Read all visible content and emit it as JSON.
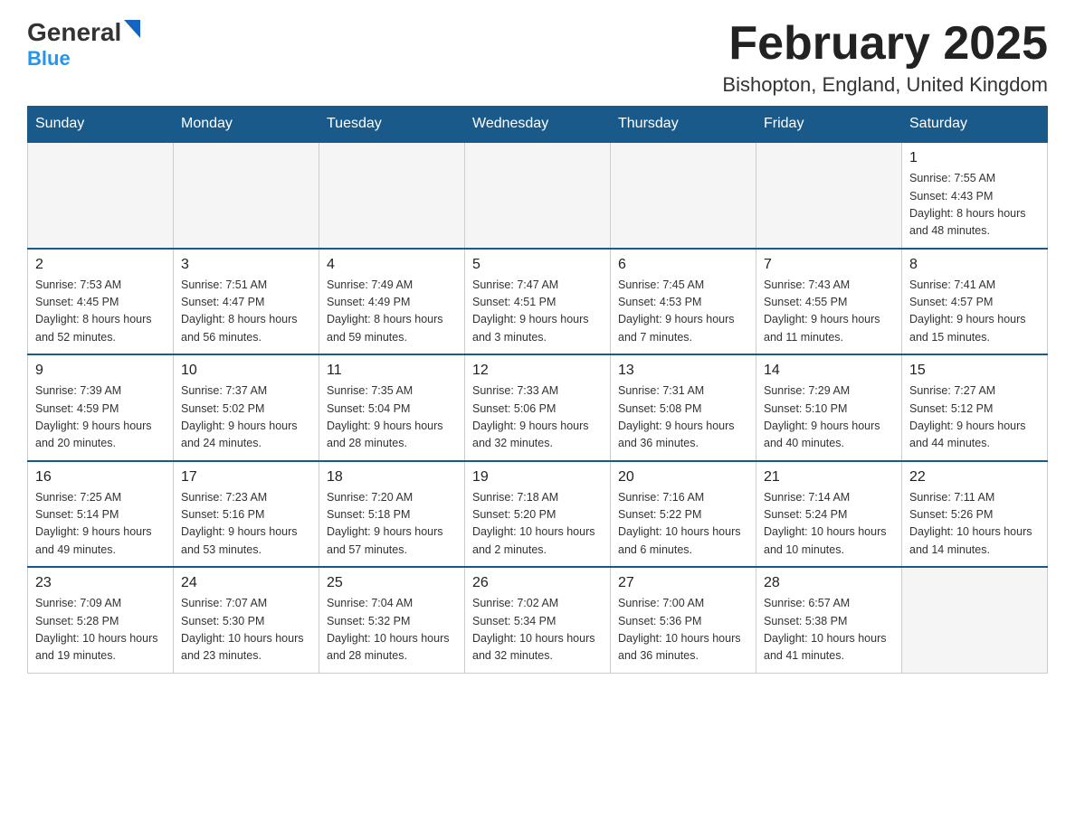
{
  "header": {
    "logo_general": "General",
    "logo_blue": "Blue",
    "month_title": "February 2025",
    "location": "Bishopton, England, United Kingdom"
  },
  "weekdays": [
    "Sunday",
    "Monday",
    "Tuesday",
    "Wednesday",
    "Thursday",
    "Friday",
    "Saturday"
  ],
  "weeks": [
    [
      {
        "day": "",
        "empty": true
      },
      {
        "day": "",
        "empty": true
      },
      {
        "day": "",
        "empty": true
      },
      {
        "day": "",
        "empty": true
      },
      {
        "day": "",
        "empty": true
      },
      {
        "day": "",
        "empty": true
      },
      {
        "day": "1",
        "sunrise": "7:55 AM",
        "sunset": "4:43 PM",
        "daylight": "8 hours and 48 minutes."
      }
    ],
    [
      {
        "day": "2",
        "sunrise": "7:53 AM",
        "sunset": "4:45 PM",
        "daylight": "8 hours and 52 minutes."
      },
      {
        "day": "3",
        "sunrise": "7:51 AM",
        "sunset": "4:47 PM",
        "daylight": "8 hours and 56 minutes."
      },
      {
        "day": "4",
        "sunrise": "7:49 AM",
        "sunset": "4:49 PM",
        "daylight": "8 hours and 59 minutes."
      },
      {
        "day": "5",
        "sunrise": "7:47 AM",
        "sunset": "4:51 PM",
        "daylight": "9 hours and 3 minutes."
      },
      {
        "day": "6",
        "sunrise": "7:45 AM",
        "sunset": "4:53 PM",
        "daylight": "9 hours and 7 minutes."
      },
      {
        "day": "7",
        "sunrise": "7:43 AM",
        "sunset": "4:55 PM",
        "daylight": "9 hours and 11 minutes."
      },
      {
        "day": "8",
        "sunrise": "7:41 AM",
        "sunset": "4:57 PM",
        "daylight": "9 hours and 15 minutes."
      }
    ],
    [
      {
        "day": "9",
        "sunrise": "7:39 AM",
        "sunset": "4:59 PM",
        "daylight": "9 hours and 20 minutes."
      },
      {
        "day": "10",
        "sunrise": "7:37 AM",
        "sunset": "5:02 PM",
        "daylight": "9 hours and 24 minutes."
      },
      {
        "day": "11",
        "sunrise": "7:35 AM",
        "sunset": "5:04 PM",
        "daylight": "9 hours and 28 minutes."
      },
      {
        "day": "12",
        "sunrise": "7:33 AM",
        "sunset": "5:06 PM",
        "daylight": "9 hours and 32 minutes."
      },
      {
        "day": "13",
        "sunrise": "7:31 AM",
        "sunset": "5:08 PM",
        "daylight": "9 hours and 36 minutes."
      },
      {
        "day": "14",
        "sunrise": "7:29 AM",
        "sunset": "5:10 PM",
        "daylight": "9 hours and 40 minutes."
      },
      {
        "day": "15",
        "sunrise": "7:27 AM",
        "sunset": "5:12 PM",
        "daylight": "9 hours and 44 minutes."
      }
    ],
    [
      {
        "day": "16",
        "sunrise": "7:25 AM",
        "sunset": "5:14 PM",
        "daylight": "9 hours and 49 minutes."
      },
      {
        "day": "17",
        "sunrise": "7:23 AM",
        "sunset": "5:16 PM",
        "daylight": "9 hours and 53 minutes."
      },
      {
        "day": "18",
        "sunrise": "7:20 AM",
        "sunset": "5:18 PM",
        "daylight": "9 hours and 57 minutes."
      },
      {
        "day": "19",
        "sunrise": "7:18 AM",
        "sunset": "5:20 PM",
        "daylight": "10 hours and 2 minutes."
      },
      {
        "day": "20",
        "sunrise": "7:16 AM",
        "sunset": "5:22 PM",
        "daylight": "10 hours and 6 minutes."
      },
      {
        "day": "21",
        "sunrise": "7:14 AM",
        "sunset": "5:24 PM",
        "daylight": "10 hours and 10 minutes."
      },
      {
        "day": "22",
        "sunrise": "7:11 AM",
        "sunset": "5:26 PM",
        "daylight": "10 hours and 14 minutes."
      }
    ],
    [
      {
        "day": "23",
        "sunrise": "7:09 AM",
        "sunset": "5:28 PM",
        "daylight": "10 hours and 19 minutes."
      },
      {
        "day": "24",
        "sunrise": "7:07 AM",
        "sunset": "5:30 PM",
        "daylight": "10 hours and 23 minutes."
      },
      {
        "day": "25",
        "sunrise": "7:04 AM",
        "sunset": "5:32 PM",
        "daylight": "10 hours and 28 minutes."
      },
      {
        "day": "26",
        "sunrise": "7:02 AM",
        "sunset": "5:34 PM",
        "daylight": "10 hours and 32 minutes."
      },
      {
        "day": "27",
        "sunrise": "7:00 AM",
        "sunset": "5:36 PM",
        "daylight": "10 hours and 36 minutes."
      },
      {
        "day": "28",
        "sunrise": "6:57 AM",
        "sunset": "5:38 PM",
        "daylight": "10 hours and 41 minutes."
      },
      {
        "day": "",
        "empty": true
      }
    ]
  ],
  "labels": {
    "sunrise": "Sunrise:",
    "sunset": "Sunset:",
    "daylight": "Daylight:"
  }
}
